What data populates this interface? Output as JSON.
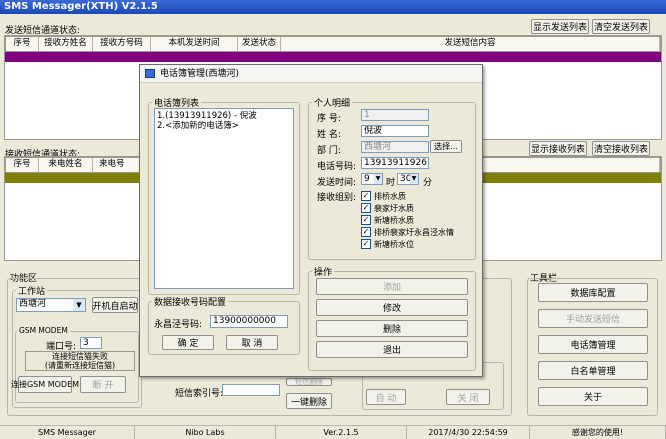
{
  "app": {
    "title": "SMS Messager(XTH) V2.1.5"
  },
  "send_panel": {
    "caption": "发送短信通道状态:",
    "show_btn": "显示发送列表",
    "clear_btn": "清空发送列表",
    "columns": [
      "序号",
      "接收方姓名",
      "接收方号码",
      "本机发送时间",
      "发送状态",
      "发送短信内容"
    ]
  },
  "recv_panel": {
    "caption": "接收短信通道状态:",
    "show_btn": "显示接收列表",
    "clear_btn": "清空接收列表",
    "columns": [
      "序号",
      "来电姓名",
      "来电号"
    ]
  },
  "func": {
    "caption": "功能区",
    "workstation": "工作站",
    "station_value": "西塘河",
    "auto_start": "开机自启动",
    "gsm_caption": "GSM MODEM",
    "port_label": "端口号:",
    "port_value": "3",
    "status_line1": "连接短信猫失败",
    "status_line2": "(请重新连接短信猫)",
    "connect_btn": "连接GSM MODEM",
    "disconnect_btn": "断 开",
    "index_label": "短信索引号:",
    "one_delete": "一键删除",
    "auto_btn": "自 动",
    "close_btn": "关 闭",
    "partial_btn": "短信删除"
  },
  "toolbar": {
    "caption": "工具栏",
    "items": [
      "数据库配置",
      "手动发送短信",
      "电话簿管理",
      "白名单管理",
      "关于"
    ]
  },
  "status_bar": {
    "app": "SMS Messager",
    "vendor": "Nibo Labs",
    "version": "Ver.2.1.5",
    "datetime": "2017/4/30 22:54:59",
    "thanks": "感谢您的使用!"
  },
  "dialog": {
    "title": "电话簿管理(西塘河)",
    "list_caption": "电话簿列表",
    "list_items": [
      "1.(13913911926) - 倪波",
      "2.<添加新的电话簿>"
    ],
    "config_caption": "数据接收号码配置",
    "yongchang_label": "永昌泾号码:",
    "yongchang_value": "13900000000",
    "ok_btn": "确 定",
    "cancel_btn": "取 消",
    "detail_caption": "个人明细",
    "seq_label": "序    号:",
    "seq_value": "1",
    "name_label": "姓    名:",
    "name_value": "倪波",
    "dept_label": "部    门:",
    "dept_value": "西塘河",
    "select_btn": "选择...",
    "phone_label": "电话号码:",
    "phone_value": "13913911926",
    "time_label": "发送时间:",
    "hour_value": "9",
    "hour_unit": "时",
    "min_value": "30",
    "min_unit": "分",
    "group_label": "接收组别:",
    "groups": [
      "排桥水质",
      "裴家圩水质",
      "新塘桥水质",
      "排桥裴家圩永昌泾水情",
      "新塘桥水位"
    ],
    "ops_caption": "操作",
    "ops": [
      "添加",
      "修改",
      "删除",
      "退出"
    ]
  }
}
